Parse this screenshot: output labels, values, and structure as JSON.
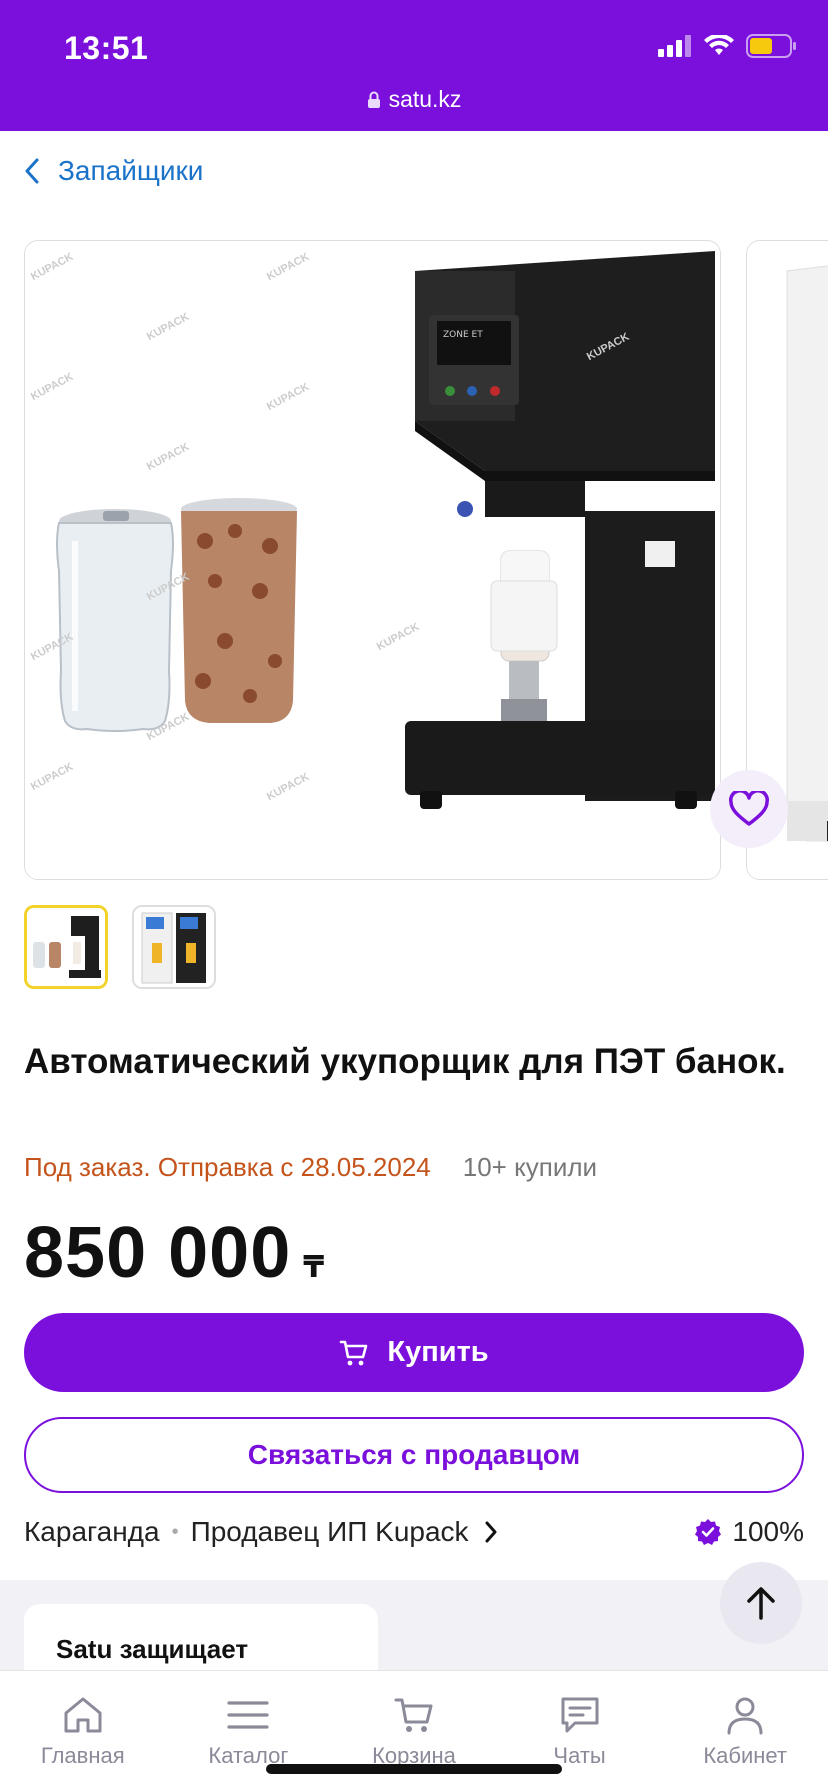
{
  "status": {
    "time": "13:51",
    "url": "satu.kz"
  },
  "breadcrumb": {
    "label": "Запайщики"
  },
  "product": {
    "title": "Автоматический укупорщик для ПЭТ банок.",
    "shipping": "Под заказ. Отправка с 28.05.2024",
    "bought": "10+ купили",
    "price": "850 000",
    "currency": "₸",
    "watermark": "KUPACK",
    "machine_brand": "ZONE ET"
  },
  "actions": {
    "buy_label": "Купить",
    "contact_label": "Связаться с продавцом"
  },
  "seller": {
    "city": "Караганда",
    "name": "Продавец ИП Kupack",
    "rating": "100%"
  },
  "protect": {
    "title": "Satu защищает"
  },
  "tabbar": [
    {
      "label": "Главная",
      "icon": "home-icon"
    },
    {
      "label": "Каталог",
      "icon": "menu-icon"
    },
    {
      "label": "Корзина",
      "icon": "cart-icon"
    },
    {
      "label": "Чаты",
      "icon": "chat-icon"
    },
    {
      "label": "Кабинет",
      "icon": "profile-icon"
    }
  ],
  "colors": {
    "brand": "#7b10dc",
    "link": "#1a73c9",
    "shipping": "#c4541b"
  }
}
